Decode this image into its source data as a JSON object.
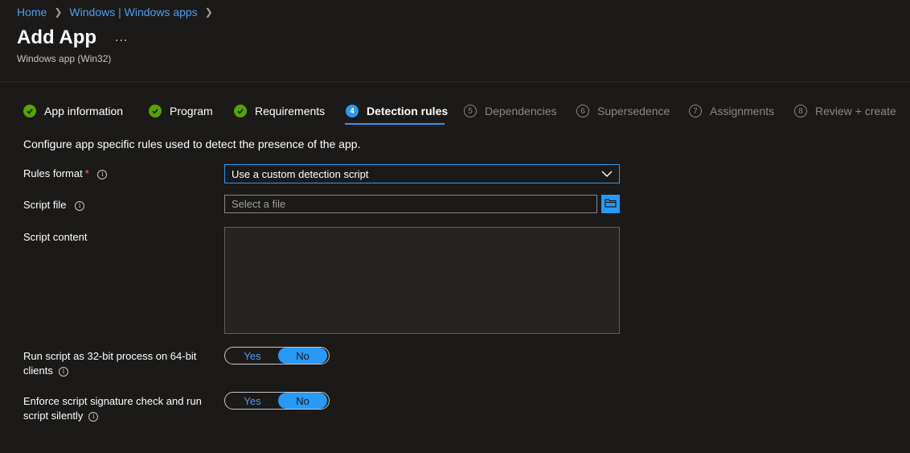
{
  "breadcrumb": {
    "home": "Home",
    "apps": "Windows | Windows apps"
  },
  "page": {
    "title": "Add App",
    "more": "...",
    "subtitle": "Windows app (Win32)"
  },
  "tabs": [
    {
      "label": "App information",
      "state": "done"
    },
    {
      "label": "Program",
      "state": "done"
    },
    {
      "label": "Requirements",
      "state": "done"
    },
    {
      "label": "Detection rules",
      "state": "active",
      "number": "4"
    },
    {
      "label": "Dependencies",
      "state": "pending",
      "number": "5"
    },
    {
      "label": "Supersedence",
      "state": "pending",
      "number": "6"
    },
    {
      "label": "Assignments",
      "state": "pending",
      "number": "7"
    },
    {
      "label": "Review + create",
      "state": "pending",
      "number": "8"
    }
  ],
  "form": {
    "description": "Configure app specific rules used to detect the presence of the app.",
    "rules_format": {
      "label": "Rules format",
      "required_mark": "*",
      "value": "Use a custom detection script"
    },
    "script_file": {
      "label": "Script file",
      "placeholder": "Select a file"
    },
    "script_content": {
      "label": "Script content",
      "value": ""
    },
    "run_32bit": {
      "label_line1": "Run script as 32-bit process on 64-bit",
      "label_line2": "clients",
      "yes": "Yes",
      "no": "No",
      "selected": "No"
    },
    "enforce_signature": {
      "label_line1": "Enforce script signature check and run",
      "label_line2": "script silently",
      "yes": "Yes",
      "no": "No",
      "selected": "No"
    }
  },
  "colors": {
    "accent": "#2899f5",
    "success": "#57a300",
    "link": "#4aa0f0",
    "background": "#1b1a19"
  },
  "icons": {
    "done": "checkmark-icon",
    "info": "info-icon",
    "dropdown": "chevron-down-icon",
    "browse": "folder-icon",
    "breadcrumb_sep": "chevron-right-icon"
  }
}
